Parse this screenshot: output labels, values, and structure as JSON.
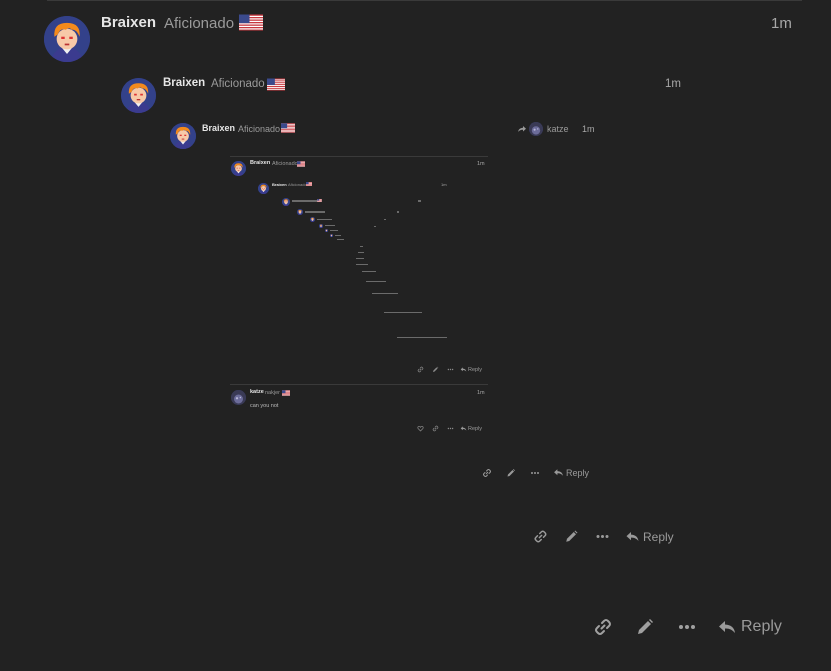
{
  "thread": {
    "level1": {
      "username": "Braixen",
      "user_title": "Aficionado",
      "flag": "us-flag",
      "time": "1m",
      "reply_label": "Reply"
    },
    "level2": {
      "username": "Braixen",
      "user_title": "Aficionado",
      "flag": "us-flag",
      "time": "1m",
      "reply_label": "Reply"
    },
    "level3": {
      "username": "Braixen",
      "user_title": "Aficionado",
      "flag": "us-flag",
      "reply_to_user": "katze",
      "time": "1m",
      "reply_label": "Reply"
    },
    "level4": {
      "username": "Braixen",
      "user_title": "Aficionado",
      "time": "1m",
      "reply_label": "Reply"
    },
    "level5": {
      "username": "Braixen",
      "user_title": "Aficionado",
      "time": "1m"
    },
    "katze_post": {
      "username": "katze",
      "user_title": "nakjer",
      "time": "1m",
      "body": "can you not",
      "reply_label": "Reply"
    }
  },
  "icons": {
    "link": "link-icon",
    "edit": "pencil-icon",
    "more": "ellipsis-icon",
    "reply": "reply-icon",
    "like": "heart-icon"
  },
  "colors": {
    "background": "#222222",
    "text": "#dddddd",
    "muted": "#9a9a9a",
    "avatar_bg": "#2c3a78"
  }
}
